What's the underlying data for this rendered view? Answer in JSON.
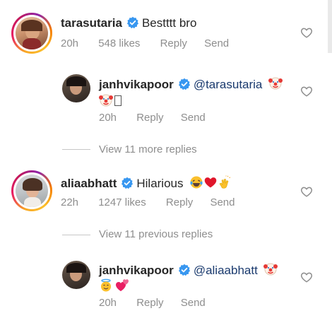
{
  "comments": [
    {
      "username": "tarasutaria",
      "text": "Bestttt bro",
      "time": "20h",
      "likes": "548 likes",
      "reply": "Reply",
      "send": "Send"
    },
    {
      "username": "janhvikapoor",
      "mention": "@tarasutaria",
      "time": "20h",
      "reply": "Reply",
      "send": "Send"
    },
    {
      "username": "aliaabhatt",
      "text": "Hilarious",
      "time": "22h",
      "likes": "1247 likes",
      "reply": "Reply",
      "send": "Send"
    },
    {
      "username": "janhvikapoor",
      "mention": "@aliaabhatt",
      "time": "20h",
      "reply": "Reply",
      "send": "Send"
    }
  ],
  "view_more_replies": "View 11 more replies",
  "view_previous_replies": "View 11 previous replies",
  "colors": {
    "text": "#262626",
    "meta": "#8e8e8e",
    "mention": "#1a3a6e",
    "verified": "#3897f0"
  },
  "icons": [
    "verified-badge-icon",
    "heart-outline-icon",
    "clown-face-emoji",
    "laughing-emoji",
    "red-heart-emoji",
    "clapping-hands-emoji",
    "angel-face-emoji",
    "two-hearts-emoji",
    "missing-glyph-box"
  ]
}
